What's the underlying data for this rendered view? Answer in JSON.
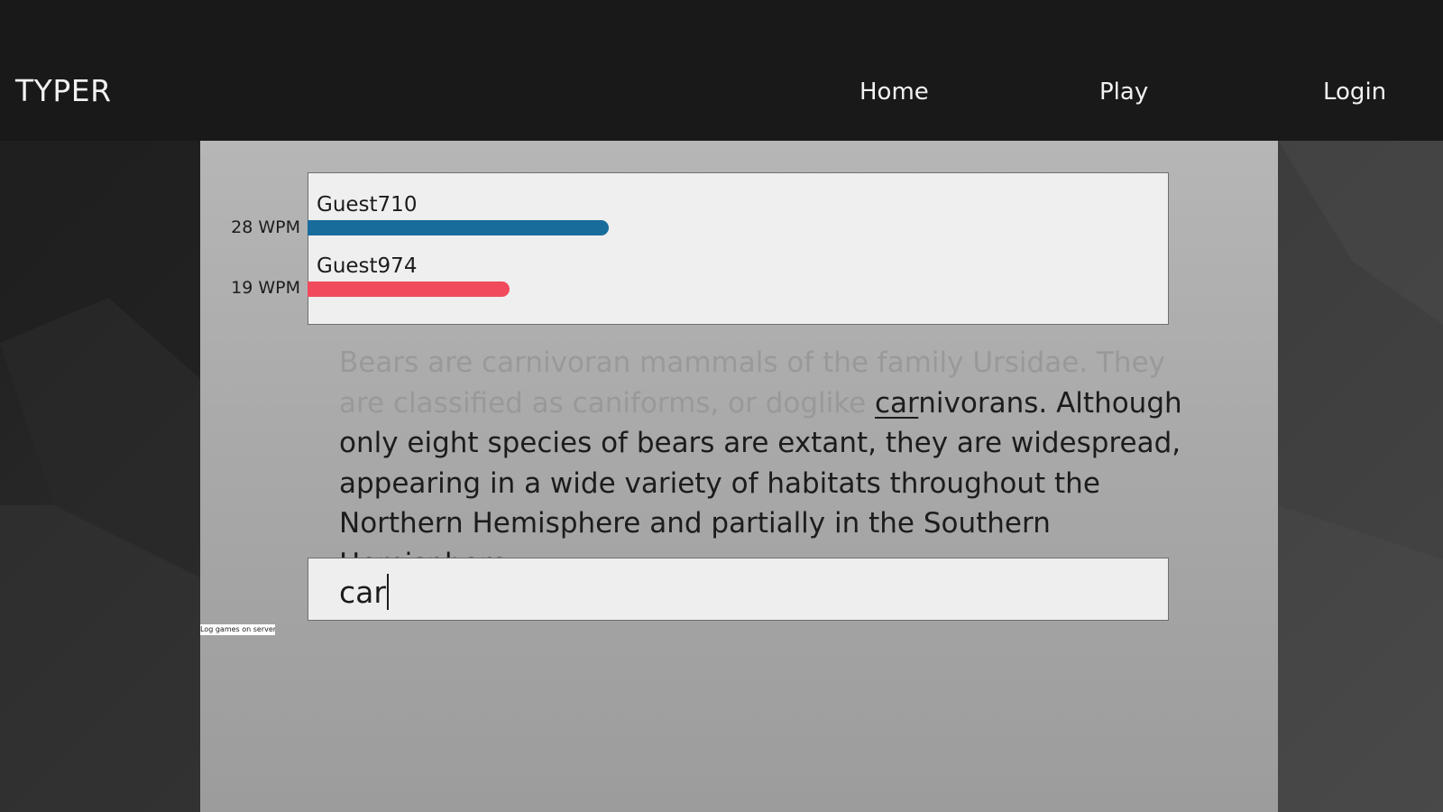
{
  "app": {
    "brand": "TYPER"
  },
  "nav": {
    "items": [
      {
        "label": "Home"
      },
      {
        "label": "Play"
      },
      {
        "label": "Login"
      }
    ]
  },
  "race": {
    "players": [
      {
        "name": "Guest710",
        "wpm_label": "28 WPM",
        "progress": 0.35,
        "color": "#186c9c"
      },
      {
        "name": "Guest974",
        "wpm_label": "19 WPM",
        "progress": 0.235,
        "color": "#f04a5c"
      }
    ]
  },
  "passage": {
    "typed": "Bears are carnivoran mammals of the family Ursidae. They are classified as caniforms, or doglike ",
    "current_typed": "car",
    "current_rest": "nivorans.",
    "remaining": " Although only eight species of bears are extant, they are widespread, appearing in a wide variety of habitats throughout the Northern Hemisphere and partially in the Southern Hemisphere."
  },
  "input": {
    "value": "car"
  },
  "log_button": {
    "label": "Log games on server"
  },
  "colors": {
    "navbar": "#191919",
    "panel": "#aaaaaa",
    "typed_text": "#999999",
    "player1_bar": "#186c9c",
    "player2_bar": "#f04a5c"
  }
}
